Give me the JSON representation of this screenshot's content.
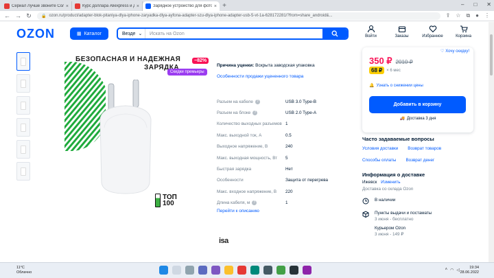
{
  "browser": {
    "tabs": [
      {
        "title": "Сериал Лучше звоните Солу 1...",
        "color": "#e53935",
        "active": false
      },
      {
        "title": "Курс доллара Aliexpress и друг...",
        "color": "#e53935",
        "active": false
      },
      {
        "title": "Зарядное устройство для фото...",
        "color": "#005bff",
        "active": true
      }
    ],
    "new_tab": "+",
    "url": "ozon.ru/product/adapter-blok-pitaniya-dlya-iphone-zaryadka-dlya-ayfona-adapter-szu-dlya-iphone-adapter-usb-5-vt-1a-628172281/?from=share_android&..."
  },
  "header": {
    "logo": "OZON",
    "catalog_label": "Каталог",
    "search_scope": "Везде",
    "search_placeholder": "Искать на Ozon",
    "icons": [
      {
        "label": "Войти",
        "icon": "user-icon"
      },
      {
        "label": "Заказы",
        "icon": "box-icon"
      },
      {
        "label": "Избранное",
        "icon": "heart-icon"
      },
      {
        "label": "Корзина",
        "icon": "cart-icon"
      }
    ]
  },
  "product": {
    "banner_line1": "БЕЗОПАСНАЯ И НАДЕЖНАЯ",
    "banner_line2": "ЗАРЯДКА",
    "discount": "−82%",
    "premium_badge": "Скидки премьеры",
    "top_badge_line1": "ТОП",
    "top_badge_line2": "100",
    "brand": "isa"
  },
  "info": {
    "reason_label": "Причина уценки:",
    "reason_value": "Вскрыта заводская упаковка",
    "peculiarities_link": "Особенности продажи уцененного товара"
  },
  "specs": [
    {
      "key": "Разъем на кабеле",
      "value": "USB 3.0 Type-B",
      "help": true,
      "link": false
    },
    {
      "key": "Разъем на блоке",
      "value": "USB 2.0 Type-A",
      "help": true,
      "link": false
    },
    {
      "key": "Количество выходных разъемов",
      "value": "1",
      "help": false,
      "link": false
    },
    {
      "key": "Макс. выходной ток, А",
      "value": "0.5",
      "help": false,
      "link": false
    },
    {
      "key": "Выходное напряжение, В",
      "value": "240",
      "help": false,
      "link": false
    },
    {
      "key": "Макс. выходная мощность, Вт",
      "value": "5",
      "help": false,
      "link": false
    },
    {
      "key": "Быстрая зарядка",
      "value": "Нет",
      "help": false,
      "link": false
    },
    {
      "key": "Особенности",
      "value": "Защита от перегрева",
      "help": false,
      "link": false
    },
    {
      "key": "Макс. входное напряжение, В",
      "value": "220",
      "help": false,
      "link": false
    },
    {
      "key": "Длина кабеля, м",
      "value": "1",
      "help": true,
      "link": false
    }
  ],
  "description_link": "Перейти к описанию",
  "price_card": {
    "want_discount": "Хочу скидку!",
    "price": "350 ₽",
    "old_price": "2010 ₽",
    "installment": "68 ₽",
    "installment_term": "× 6 мес",
    "notify": "Узнать о снижении цены",
    "add_to_cart": "Добавить в корзину",
    "delivery_days": "Доставка 3 дня"
  },
  "faq": {
    "title": "Часто задаваемые вопросы",
    "links": [
      "Условия доставки",
      "Возврат товаров",
      "Способы оплаты",
      "Возврат денег"
    ]
  },
  "delivery_info": {
    "title": "Информация о доставке",
    "city": "Ижевск",
    "change": "Изменить",
    "warehouse": "Доставка со склада Ozon",
    "in_stock": "В наличии",
    "pickup_title": "Пункты выдачи и постаматы",
    "pickup_sub": "3 июня - бесплатно",
    "courier_title": "Курьером Ozon",
    "courier_sub": "3 июня - 149 ₽"
  },
  "taskbar": {
    "weather_temp": "11°C",
    "weather_desc": "Облачно",
    "time": "19:34",
    "date": "28.06.2022"
  }
}
